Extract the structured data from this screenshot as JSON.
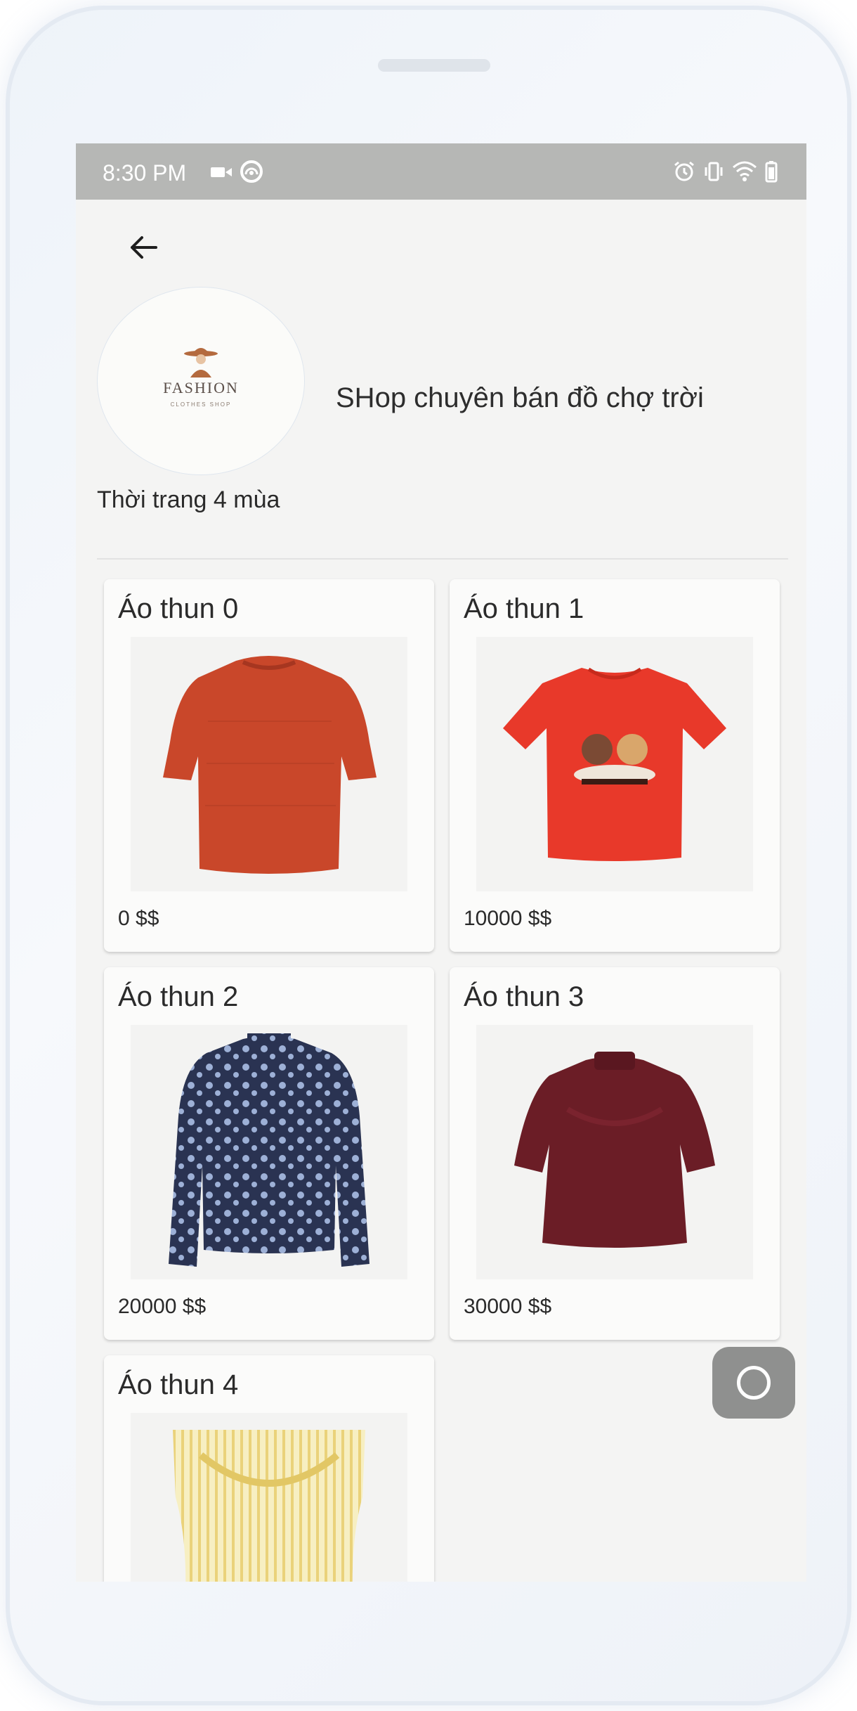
{
  "status_bar": {
    "time": "8:30 PM",
    "left_icons": [
      "video-camera-icon",
      "cast-icon"
    ],
    "right_icons": [
      "alarm-icon",
      "vibrate-icon",
      "wifi-icon",
      "battery-icon"
    ]
  },
  "header": {
    "back_icon": "arrow-left-icon"
  },
  "shop": {
    "logo_text": "FASHION",
    "logo_subtext": "CLOTHES SHOP",
    "description": "SHop chuyên bán đồ chợ trời",
    "name": "Thời trang 4 mùa"
  },
  "products": [
    {
      "title": "Áo thun 0",
      "price": "0 $$",
      "image": "orange-knit-top",
      "color": "#c9472a"
    },
    {
      "title": "Áo thun 1",
      "price": "10000 $$",
      "image": "red-graphic-tshirt",
      "color": "#e8392a"
    },
    {
      "title": "Áo thun 2",
      "price": "20000 $$",
      "image": "navy-floral-long-sleeve",
      "color": "#2a3352"
    },
    {
      "title": "Áo thun 3",
      "price": "30000 $$",
      "image": "burgundy-velvet-top",
      "color": "#6b1d26"
    },
    {
      "title": "Áo thun 4",
      "price": "",
      "image": "yellow-striped-ruffle-top",
      "color": "#f3e7a8"
    }
  ],
  "fab": {
    "icon": "circle-home-icon"
  }
}
